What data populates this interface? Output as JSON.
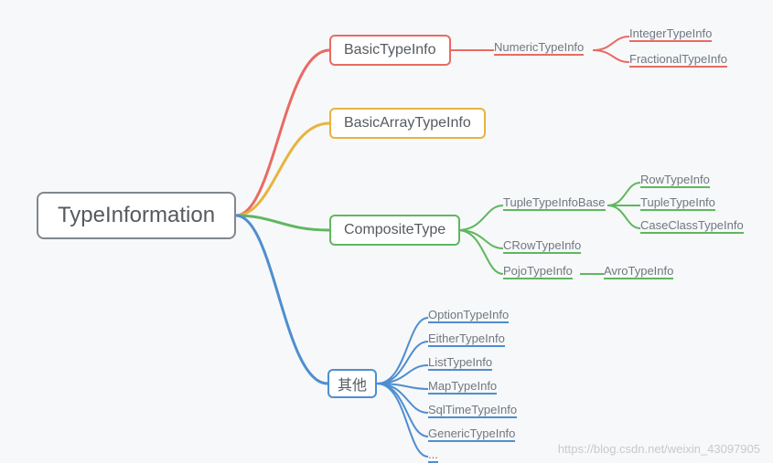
{
  "root": {
    "label": "TypeInformation"
  },
  "branches": {
    "basic": {
      "label": "BasicTypeInfo"
    },
    "array": {
      "label": "BasicArrayTypeInfo"
    },
    "composite": {
      "label": "CompositeType"
    },
    "other": {
      "label": "其他"
    }
  },
  "leaves": {
    "basic_numeric": "NumericTypeInfo",
    "basic_integer": "IntegerTypeInfo",
    "basic_fractional": "FractionalTypeInfo",
    "comp_tupleBase": "TupleTypeInfoBase",
    "comp_crow": "CRowTypeInfo",
    "comp_pojo": "PojoTypeInfo",
    "comp_row": "RowTypeInfo",
    "comp_tuple": "TupleTypeInfo",
    "comp_caseclass": "CaseClassTypeInfo",
    "comp_avro": "AvroTypeInfo",
    "other_option": "OptionTypeInfo",
    "other_either": "EitherTypeInfo",
    "other_list": "ListTypeInfo",
    "other_map": "MapTypeInfo",
    "other_sqltime": "SqlTimeTypeInfo",
    "other_generic": "GenericTypeInfo",
    "other_more": "..."
  },
  "watermark": "https://blog.csdn.net/weixin_43097905",
  "chart_data": {
    "type": "tree",
    "root": "TypeInformation",
    "children": [
      {
        "name": "BasicTypeInfo",
        "color": "#e86b63",
        "children": [
          {
            "name": "NumericTypeInfo",
            "children": [
              {
                "name": "IntegerTypeInfo"
              },
              {
                "name": "FractionalTypeInfo"
              }
            ]
          }
        ]
      },
      {
        "name": "BasicArrayTypeInfo",
        "color": "#e8b33f"
      },
      {
        "name": "CompositeType",
        "color": "#5fb760",
        "children": [
          {
            "name": "TupleTypeInfoBase",
            "children": [
              {
                "name": "RowTypeInfo"
              },
              {
                "name": "TupleTypeInfo"
              },
              {
                "name": "CaseClassTypeInfo"
              }
            ]
          },
          {
            "name": "CRowTypeInfo"
          },
          {
            "name": "PojoTypeInfo",
            "children": [
              {
                "name": "AvroTypeInfo"
              }
            ]
          }
        ]
      },
      {
        "name": "其他",
        "color": "#4f8ed0",
        "children": [
          {
            "name": "OptionTypeInfo"
          },
          {
            "name": "EitherTypeInfo"
          },
          {
            "name": "ListTypeInfo"
          },
          {
            "name": "MapTypeInfo"
          },
          {
            "name": "SqlTimeTypeInfo"
          },
          {
            "name": "GenericTypeInfo"
          },
          {
            "name": "..."
          }
        ]
      }
    ]
  }
}
